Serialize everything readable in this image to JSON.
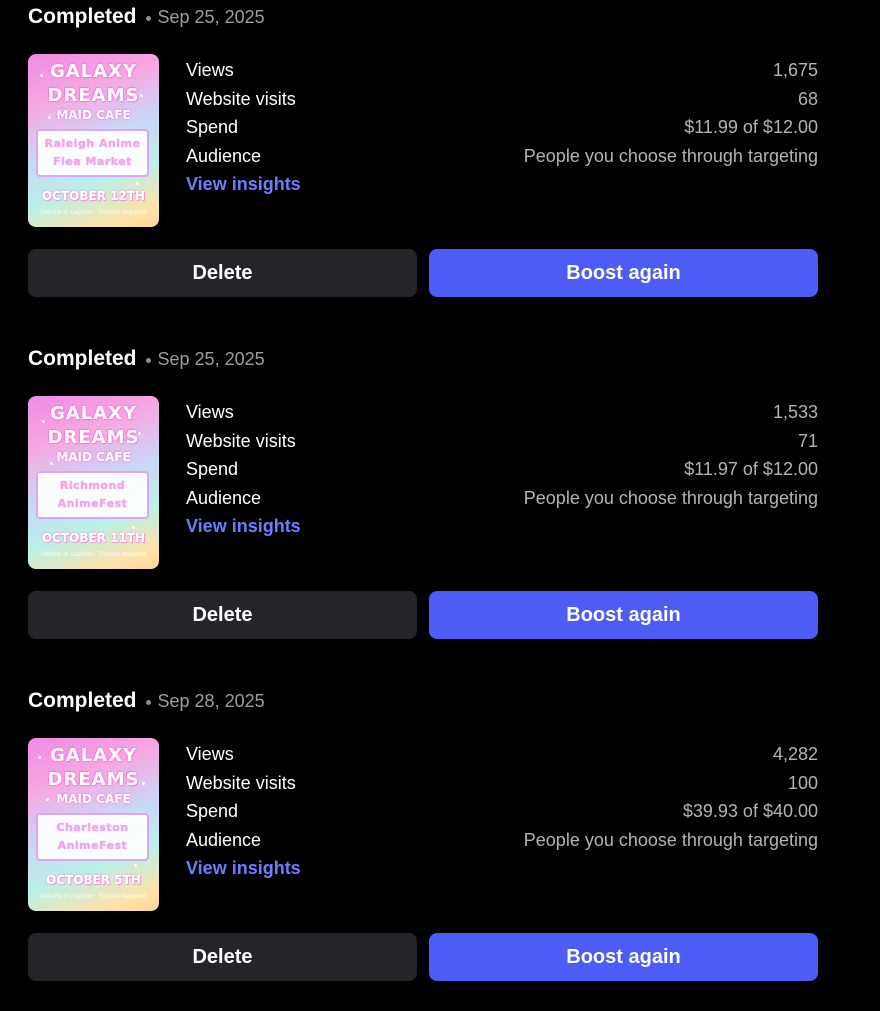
{
  "colors": {
    "background": "#000000",
    "delete_button": "#232529",
    "boost_button": "#4c5cf5",
    "link": "#6c7dff",
    "muted_text": "#b0b3b8"
  },
  "boosts": [
    {
      "status": "Completed",
      "date": "Sep 25, 2025",
      "thumbnail": {
        "title_line1": "GALAXY",
        "title_line2": "DREAMS",
        "subtitle": "MAID CAFE",
        "event_line1": "Raleigh Anime",
        "event_line2": "Flea Market",
        "event_date": "OCTOBER 12TH",
        "fine_print": "Details in caption · Tickets required"
      },
      "stats": [
        {
          "label": "Views",
          "value": "1,675"
        },
        {
          "label": "Website visits",
          "value": "68"
        },
        {
          "label": "Spend",
          "value": "$11.99 of $12.00"
        },
        {
          "label": "Audience",
          "value": "People you choose through targeting"
        }
      ],
      "insights_label": "View insights",
      "delete_label": "Delete",
      "boost_label": "Boost again"
    },
    {
      "status": "Completed",
      "date": "Sep 25, 2025",
      "thumbnail": {
        "title_line1": "GALAXY",
        "title_line2": "DREAMS",
        "subtitle": "MAID CAFE",
        "event_line1": "Richmond",
        "event_line2": "AnimeFest",
        "event_date": "OCTOBER 11TH",
        "fine_print": "Details in caption · Tickets required"
      },
      "stats": [
        {
          "label": "Views",
          "value": "1,533"
        },
        {
          "label": "Website visits",
          "value": "71"
        },
        {
          "label": "Spend",
          "value": "$11.97 of $12.00"
        },
        {
          "label": "Audience",
          "value": "People you choose through targeting"
        }
      ],
      "insights_label": "View insights",
      "delete_label": "Delete",
      "boost_label": "Boost again"
    },
    {
      "status": "Completed",
      "date": "Sep 28, 2025",
      "thumbnail": {
        "title_line1": "GALAXY",
        "title_line2": "DREAMS",
        "subtitle": "MAID CAFE",
        "event_line1": "Charleston",
        "event_line2": "AnimeFest",
        "event_date": "OCTOBER 5TH",
        "fine_print": "Details in caption · Tickets required"
      },
      "stats": [
        {
          "label": "Views",
          "value": "4,282"
        },
        {
          "label": "Website visits",
          "value": "100"
        },
        {
          "label": "Spend",
          "value": "$39.93 of $40.00"
        },
        {
          "label": "Audience",
          "value": "People you choose through targeting"
        }
      ],
      "insights_label": "View insights",
      "delete_label": "Delete",
      "boost_label": "Boost again"
    }
  ]
}
